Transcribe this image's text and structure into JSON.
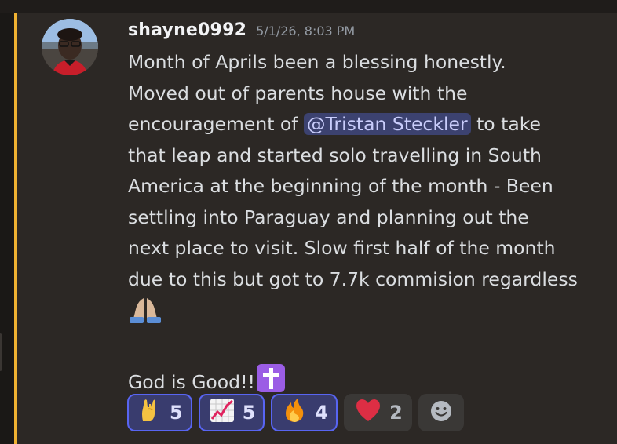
{
  "message": {
    "author": "shayne0992",
    "timestamp": "5/1/26, 8:03 PM",
    "line1": "Month of Aprils been a blessing honestly.",
    "line2": "Moved out of parents house with the",
    "line3_before": "encouragement of ",
    "mention": "@Tristan Steckler",
    "line3_after": " to take",
    "line4": "that leap and started solo travelling in South",
    "line5": "America at the beginning of the month - Been",
    "line6": "settling into Paraguay and planning out the",
    "line7": "next place to visit. Slow first half of the month",
    "line8": "due to this but got to 7.7k commision regardless",
    "closing": "God is Good!!"
  },
  "reactions": [
    {
      "emoji": "rock-on-hand",
      "count": "5",
      "reacted": true
    },
    {
      "emoji": "chart-increasing",
      "count": "5",
      "reacted": true
    },
    {
      "emoji": "fire",
      "count": "4",
      "reacted": true
    },
    {
      "emoji": "red-heart",
      "count": "2",
      "reacted": false
    }
  ],
  "colors": {
    "accent": "#f0b232",
    "mention_bg": "#3c4270",
    "reaction_active_border": "#5865f2"
  }
}
